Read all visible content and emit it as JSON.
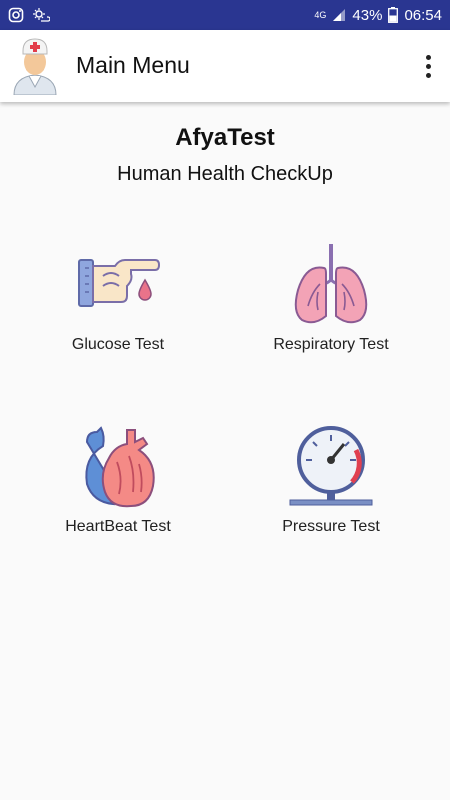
{
  "status_bar": {
    "network": "4G",
    "battery": "43%",
    "time": "06:54"
  },
  "app_bar": {
    "title": "Main Menu"
  },
  "main": {
    "app_name": "AfyaTest",
    "tagline": "Human Health CheckUp",
    "tests": [
      {
        "label": "Glucose Test",
        "icon": "finger-blood-drop-icon"
      },
      {
        "label": "Respiratory Test",
        "icon": "lungs-icon"
      },
      {
        "label": "HeartBeat Test",
        "icon": "heart-icon"
      },
      {
        "label": "Pressure Test",
        "icon": "pressure-gauge-icon"
      }
    ]
  },
  "colors": {
    "status_bar": "#2a3691",
    "background": "#fafafa",
    "icon_accent": "#e9738a",
    "icon_blue": "#5e78c4"
  }
}
